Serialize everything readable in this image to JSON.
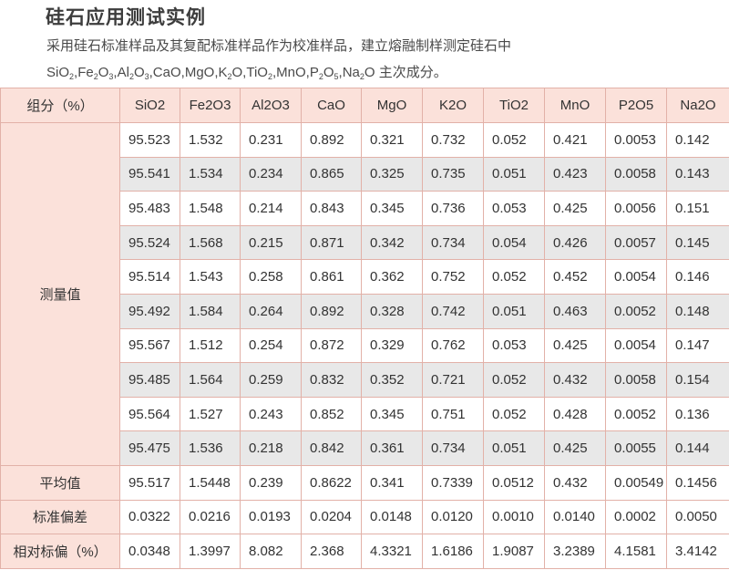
{
  "title": "硅石应用测试实例",
  "description": {
    "line1": "采用硅石标准样品及其复配标准样品作为校准样品，建立熔融制样测定硅石中",
    "suffix": "主次成分。",
    "formulas": [
      {
        "main": "SiO",
        "sub": "2",
        "tail": ""
      },
      {
        "main": "Fe",
        "sub": "2",
        "tail": ""
      },
      {
        "main": "O",
        "sub": "3",
        "tail": ""
      },
      {
        "main": "Al",
        "sub": "2",
        "tail": ""
      },
      {
        "main": "O",
        "sub": "3",
        "tail": ""
      }
    ]
  },
  "table": {
    "corner": "组分（%）",
    "columns": [
      "SiO2",
      "Fe2O3",
      "Al2O3",
      "CaO",
      "MgO",
      "K2O",
      "TiO2",
      "MnO",
      "P2O5",
      "Na2O"
    ],
    "measured_label": "测量值",
    "measured": [
      [
        "95.523",
        "1.532",
        "0.231",
        "0.892",
        "0.321",
        "0.732",
        "0.052",
        "0.421",
        "0.0053",
        "0.142"
      ],
      [
        "95.541",
        "1.534",
        "0.234",
        "0.865",
        "0.325",
        "0.735",
        "0.051",
        "0.423",
        "0.0058",
        "0.143"
      ],
      [
        "95.483",
        "1.548",
        "0.214",
        "0.843",
        "0.345",
        "0.736",
        "0.053",
        "0.425",
        "0.0056",
        "0.151"
      ],
      [
        "95.524",
        "1.568",
        "0.215",
        "0.871",
        "0.342",
        "0.734",
        "0.054",
        "0.426",
        "0.0057",
        "0.145"
      ],
      [
        "95.514",
        "1.543",
        "0.258",
        "0.861",
        "0.362",
        "0.752",
        "0.052",
        "0.452",
        "0.0054",
        "0.146"
      ],
      [
        "95.492",
        "1.584",
        "0.264",
        "0.892",
        "0.328",
        "0.742",
        "0.051",
        "0.463",
        "0.0052",
        "0.148"
      ],
      [
        "95.567",
        "1.512",
        "0.254",
        "0.872",
        "0.329",
        "0.762",
        "0.053",
        "0.425",
        "0.0054",
        "0.147"
      ],
      [
        "95.485",
        "1.564",
        "0.259",
        "0.832",
        "0.352",
        "0.721",
        "0.052",
        "0.432",
        "0.0058",
        "0.154"
      ],
      [
        "95.564",
        "1.527",
        "0.243",
        "0.852",
        "0.345",
        "0.751",
        "0.052",
        "0.428",
        "0.0052",
        "0.136"
      ],
      [
        "95.475",
        "1.536",
        "0.218",
        "0.842",
        "0.361",
        "0.734",
        "0.051",
        "0.425",
        "0.0055",
        "0.144"
      ]
    ],
    "summary": [
      {
        "label": "平均值",
        "values": [
          "95.517",
          "1.5448",
          "0.239",
          "0.8622",
          "0.341",
          "0.7339",
          "0.0512",
          "0.432",
          "0.00549",
          "0.1456"
        ]
      },
      {
        "label": "标准偏差",
        "values": [
          "0.0322",
          "0.0216",
          "0.0193",
          "0.0204",
          "0.0148",
          "0.0120",
          "0.0010",
          "0.0140",
          "0.0002",
          "0.0050"
        ]
      },
      {
        "label": "相对标偏（%）",
        "values": [
          "0.0348",
          "1.3997",
          "8.082",
          "2.368",
          "4.3321",
          "1.6186",
          "1.9087",
          "3.2389",
          "4.1581",
          "3.4142"
        ]
      }
    ]
  },
  "colors": {
    "header_bg": "#fbe1da",
    "border": "#e2b1a8",
    "shade_row": "#e8e8e8"
  }
}
